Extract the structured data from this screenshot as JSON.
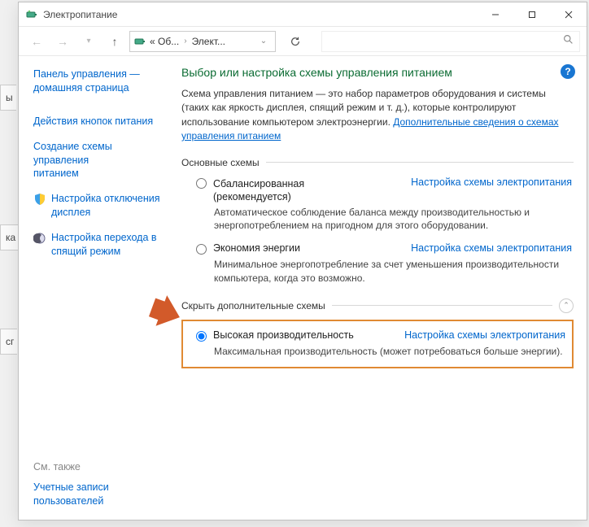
{
  "window": {
    "title": "Электропитание"
  },
  "nav": {
    "breadcrumb_seg1": "« Об...",
    "breadcrumb_seg2": "Элект...",
    "search_placeholder": ""
  },
  "sidebar": {
    "home1": "Панель управления —",
    "home2": "домашняя страница",
    "link_buttons": "Действия кнопок питания",
    "link_create1": "Создание схемы управления",
    "link_create2": "питанием",
    "link_display1": "Настройка отключения",
    "link_display2": "дисплея",
    "link_sleep1": "Настройка перехода в",
    "link_sleep2": "спящий режим",
    "see_also": "См. также",
    "link_accounts1": "Учетные записи",
    "link_accounts2": "пользователей"
  },
  "content": {
    "title": "Выбор или настройка схемы управления питанием",
    "intro_text": "Схема управления питанием — это набор параметров оборудования и системы (таких как яркость дисплея, спящий режим и т. д.), которые контролируют использование компьютером электроэнергии. ",
    "intro_link": "Дополнительные сведения о схемах управления питанием",
    "section_main": "Основные схемы",
    "section_extra": "Скрыть дополнительные схемы",
    "plans": {
      "balanced": {
        "name": "Сбалансированная",
        "rec": "(рекомендуется)",
        "link": "Настройка схемы электропитания",
        "desc": "Автоматическое соблюдение баланса между производительностью и энергопотреблением на пригодном для этого оборудовании."
      },
      "saver": {
        "name": "Экономия энергии",
        "link": "Настройка схемы электропитания",
        "desc": "Минимальное энергопотребление за счет уменьшения производительности компьютера, когда это возможно."
      },
      "perf": {
        "name": "Высокая производительность",
        "link": "Настройка схемы электропитания",
        "desc": "Максимальная производительность (может потребоваться больше энергии)."
      }
    }
  }
}
